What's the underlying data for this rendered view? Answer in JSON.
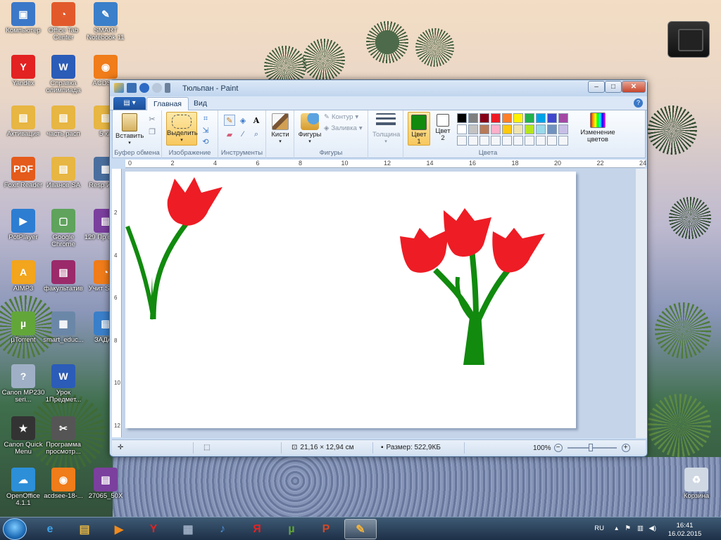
{
  "desktop": {
    "icons": [
      {
        "label": "Компьютер",
        "color": "#3c78c8",
        "glyph": "▣"
      },
      {
        "label": "Office Tab Center",
        "color": "#e25a2b",
        "glyph": "◔"
      },
      {
        "label": "SMART Notebook 11",
        "color": "#3a7fc9",
        "glyph": "✎"
      },
      {
        "label": "Yandex",
        "color": "#e32222",
        "glyph": "Y"
      },
      {
        "label": "Справка олимпиада",
        "color": "#2b5cb8",
        "glyph": "W"
      },
      {
        "label": "ACDSee",
        "color": "#f07c1a",
        "glyph": "◉"
      },
      {
        "label": "Активация",
        "color": "#e7b643",
        "glyph": "▤"
      },
      {
        "label": "часть расп",
        "color": "#e7b643",
        "glyph": "▤"
      },
      {
        "label": "5 кл",
        "color": "#e7b643",
        "glyph": "▤"
      },
      {
        "label": "Foxit Reader",
        "color": "#e45b1b",
        "glyph": "PDF"
      },
      {
        "label": "Иванов SA",
        "color": "#e7b643",
        "glyph": "▤"
      },
      {
        "label": "Resp Имит",
        "color": "#4a6f9e",
        "glyph": "▦"
      },
      {
        "label": "PotPlayer",
        "color": "#2d7dd2",
        "glyph": "▶"
      },
      {
        "label": "Google Chrome",
        "color": "#5fa35c",
        "glyph": "▢"
      },
      {
        "label": "129 Пр о сост",
        "color": "#7b3f9e",
        "glyph": "▤"
      },
      {
        "label": "AIMP3",
        "color": "#f2a51d",
        "glyph": "A"
      },
      {
        "label": "факультатив",
        "color": "#9b2a6a",
        "glyph": "▤"
      },
      {
        "label": "Учит Smart",
        "color": "#f07c1a",
        "glyph": "◔"
      },
      {
        "label": "µTorrent",
        "color": "#62a63a",
        "glyph": "µ"
      },
      {
        "label": "smart_educ...",
        "color": "#6b87a8",
        "glyph": "▦"
      },
      {
        "label": "ЗАДАН",
        "color": "#3a7fc9",
        "glyph": "▤"
      },
      {
        "label": "Canon MP230 seri...",
        "color": "#9fb0c6",
        "glyph": "?"
      },
      {
        "label": "Урок 1Предмет...",
        "color": "#2b5cb8",
        "glyph": "W"
      },
      {
        "label": "Canon Quick Menu",
        "color": "#333333",
        "glyph": "★"
      },
      {
        "label": "Программа просмотр...",
        "color": "#555555",
        "glyph": "✂"
      },
      {
        "label": "OpenOffice 4.1.1",
        "color": "#2c8fd8",
        "glyph": "☁"
      },
      {
        "label": "acdsee-18-...",
        "color": "#f07c1a",
        "glyph": "◉"
      },
      {
        "label": "27065_50X",
        "color": "#7b3f9e",
        "glyph": "▤"
      },
      {
        "label": "Корзина",
        "color": "#cfd8e3",
        "glyph": "♻"
      }
    ]
  },
  "window": {
    "title": "Тюльпан - Paint",
    "controls": {
      "minimize": "–",
      "maximize": "□",
      "close": "✕"
    }
  },
  "ribbon": {
    "file_menu": "▤ ▾",
    "tabs": [
      "Главная",
      "Вид"
    ],
    "groups": {
      "clipboard": {
        "label": "Буфер обмена",
        "paste": "Вставить"
      },
      "image": {
        "label": "Изображение",
        "select": "Выделить"
      },
      "tools": {
        "label": "Инструменты"
      },
      "brushes": {
        "label": "Кисти"
      },
      "shapes": {
        "label": "Фигуры",
        "shapes_btn": "Фигуры",
        "outline": "Контур",
        "fill": "Заливка"
      },
      "size": {
        "label": "Толщина"
      },
      "colors": {
        "label": "Цвета",
        "color1": "Цвет 1",
        "color2": "Цвет 2",
        "color1_value": "#118a0e",
        "color2_value": "#ffffff",
        "edit": "Изменение цветов",
        "palette_row1": [
          "#000000",
          "#7f7f7f",
          "#880015",
          "#ed1c24",
          "#ff7f27",
          "#fff200",
          "#22b14c",
          "#00a2e8",
          "#3f48cc",
          "#a349a4"
        ],
        "palette_row2": [
          "#ffffff",
          "#c3c3c3",
          "#b97a57",
          "#ffaec9",
          "#ffc90e",
          "#efe4b0",
          "#b5e61d",
          "#99d9ea",
          "#7092be",
          "#c8bfe7"
        ]
      }
    }
  },
  "ruler": {
    "h_ticks": [
      "0",
      "2",
      "4",
      "6",
      "8",
      "10",
      "12",
      "14",
      "16",
      "18",
      "20",
      "22",
      "24"
    ],
    "v_ticks": [
      "2",
      "4",
      "6",
      "8",
      "10",
      "12"
    ]
  },
  "status": {
    "dimensions": "21,16 × 12,94 см",
    "size": "Размер: 522,9КБ",
    "zoom": "100%",
    "zoom_out": "−",
    "zoom_in": "+"
  },
  "taskbar": {
    "lang": "RU",
    "time": "16:41",
    "date": "16.02.2015",
    "apps": [
      {
        "name": "ie",
        "glyph": "e",
        "color": "#3ea2e8"
      },
      {
        "name": "explorer",
        "glyph": "▤",
        "color": "#e7b643"
      },
      {
        "name": "media",
        "glyph": "▶",
        "color": "#f08a1c"
      },
      {
        "name": "yandex",
        "glyph": "Y",
        "color": "#e32222"
      },
      {
        "name": "calc",
        "glyph": "▦",
        "color": "#9fb0c6"
      },
      {
        "name": "sound",
        "glyph": "♪",
        "color": "#4a90d9"
      },
      {
        "name": "yandex2",
        "glyph": "Я",
        "color": "#e32222"
      },
      {
        "name": "utorrent",
        "glyph": "µ",
        "color": "#62a63a"
      },
      {
        "name": "powerpoint",
        "glyph": "P",
        "color": "#d24726"
      },
      {
        "name": "paint",
        "glyph": "✎",
        "color": "#f2b33d"
      }
    ]
  }
}
